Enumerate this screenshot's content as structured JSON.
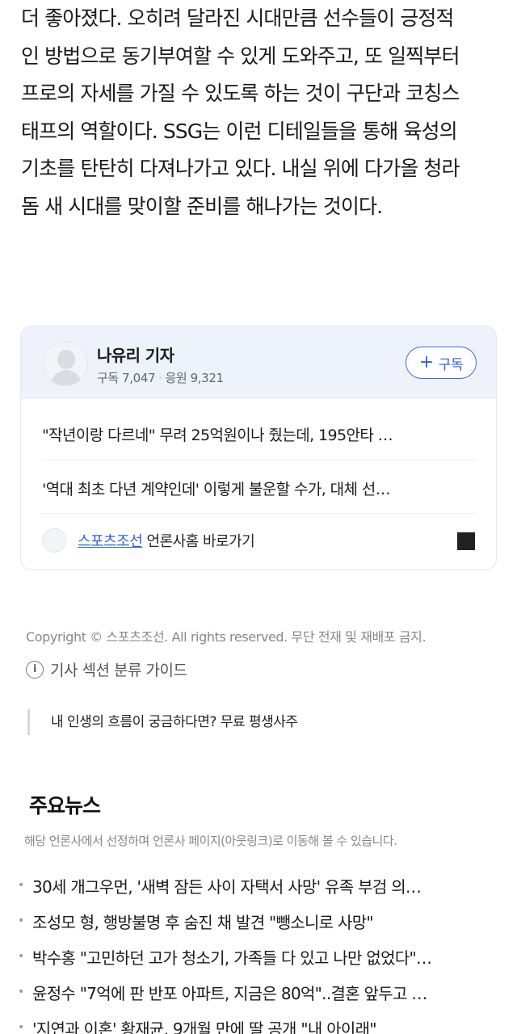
{
  "article": {
    "lines": [
      "더 좋아졌다. 오히려 달라진 시대만큼 선수들이 긍정적",
      "인 방법으로 동기부여할 수 있게 도와주고, 또 일찍부터",
      "프로의 자세를 가질 수 있도록 하는 것이 구단과 코칭스",
      "태프의 역할이다. SSG는 이런 디테일들을 통해 육성의",
      "기초를 탄탄히 다져나가고 있다. 내실 위에 다가올 청라",
      "돔 새 시대를 맞이할 준비를 해나가는 것이다."
    ]
  },
  "reporter": {
    "name": "나유리 기자",
    "subscribers": "구독 7,047",
    "cheers": "응원 9,321",
    "subscribe_plus": "+",
    "subscribe_label": "구독",
    "articles": [
      "\"작년이랑 다르네\" 무려 25억원이나 줬는데, 195안타 …",
      "'역대 최초 다년 계약인데' 이렇게 불운할 수가, 대체 선…"
    ],
    "press_name": "스포츠조선",
    "press_link_suffix": " 언론사홈 바로가기"
  },
  "footer": {
    "copyright": "Copyright © 스포츠조선. All rights reserved. 무단 전재 및 재배포 금지.",
    "guide_icon": "i",
    "guide_label": "기사 섹션 분류 가이드",
    "saju": "내 인생의 흐름이 궁금하다면? 무료 평생사주"
  },
  "major_news": {
    "title": "주요뉴스",
    "subtitle": "해당 언론사에서 선정하며 언론사 페이지(아웃링크)로 이동해 볼 수 있습니다.",
    "items": [
      "30세 개그우먼, '새벽 잠든 사이 자택서 사망' 유족 부검 의…",
      "조성모 형, 행방불명 후 숨진 채 발견 \"뺑소니로 사망\"",
      "박수홍 \"고민하던 고가 청소기, 가족들 다 있고 나만 없었다\"…",
      "윤정수 \"7억에 판 반포 아파트, 지금은 80억\"..결혼 앞두고 …",
      "'지연과 이혼' 황재균, 9개월 만에 딸 공개 \"내 아이래\""
    ]
  },
  "colors": {
    "accent": "#2f62de",
    "card_header": "#edf2fb"
  }
}
